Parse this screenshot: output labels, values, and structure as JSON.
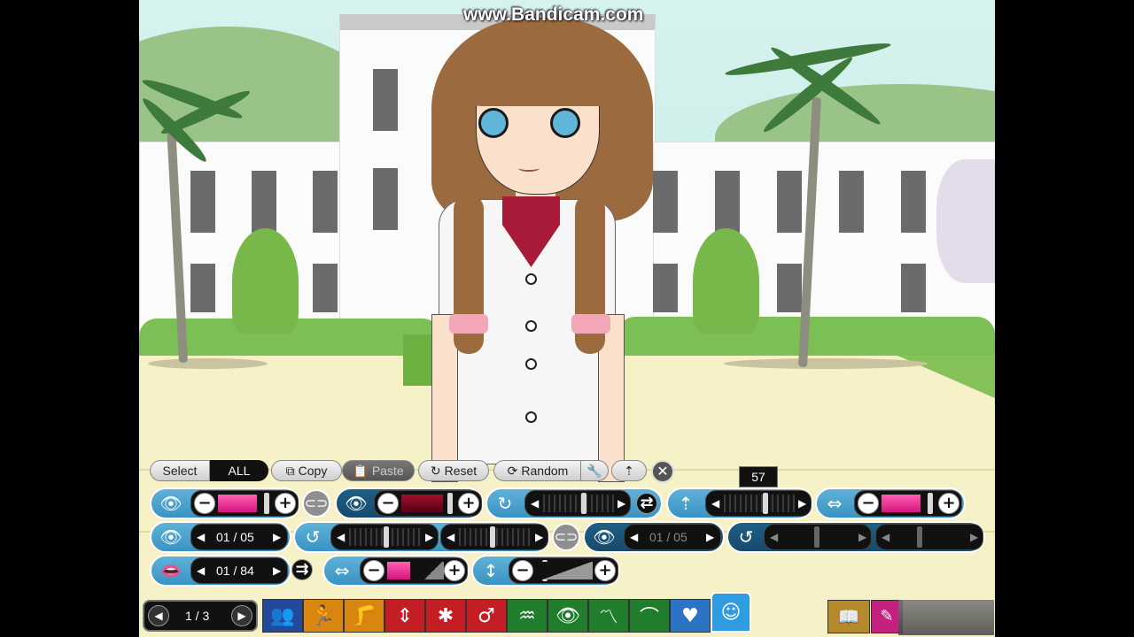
{
  "watermark": "www.Bandicam.com",
  "toolbar": {
    "select_label": "Select",
    "all_label": "ALL",
    "copy_label": "Copy",
    "paste_label": "Paste",
    "reset_label": "Reset",
    "random_label": "Random"
  },
  "tooltip_value": "57",
  "row2": {
    "eye_counter": "01 / 05",
    "eye2_counter": "01 / 05"
  },
  "row3": {
    "mouth_counter": "01 / 84"
  },
  "pager": {
    "page_label": "1 / 3"
  },
  "slider_levels": {
    "eye_color_pink": 0.85,
    "eye_color_maroon": 0.9,
    "eye_rotate_right": 0.55,
    "eye_height": 0.57,
    "eye_size_pink": 0.85,
    "eye_distance_a": 0.5,
    "eye_distance_b": 0.45,
    "mouth_color": 0.5,
    "mouth_height": 0.2
  },
  "colors": {
    "panel_blue": "#3a93c2",
    "panel_dark": "#174a6b",
    "pink": "#d4157f",
    "maroon": "#5a0015"
  },
  "categories": [
    {
      "name": "people-icon",
      "color": "#24489a"
    },
    {
      "name": "pose-icon",
      "color": "#d8860f"
    },
    {
      "name": "legs-icon",
      "color": "#d8860f"
    },
    {
      "name": "body-height-icon",
      "color": "#c41e24"
    },
    {
      "name": "body-shape-icon",
      "color": "#c41e24"
    },
    {
      "name": "gender-icon",
      "color": "#c41e24"
    },
    {
      "name": "hair-icon",
      "color": "#1f7d2c"
    },
    {
      "name": "eye-icon",
      "color": "#1f7d2c"
    },
    {
      "name": "brow-icon",
      "color": "#1f7d2c"
    },
    {
      "name": "ears-icon",
      "color": "#1f7d2c"
    },
    {
      "name": "heart-icon",
      "color": "#2b74c4"
    },
    {
      "name": "face-icon",
      "color": "#2f9be0"
    }
  ]
}
